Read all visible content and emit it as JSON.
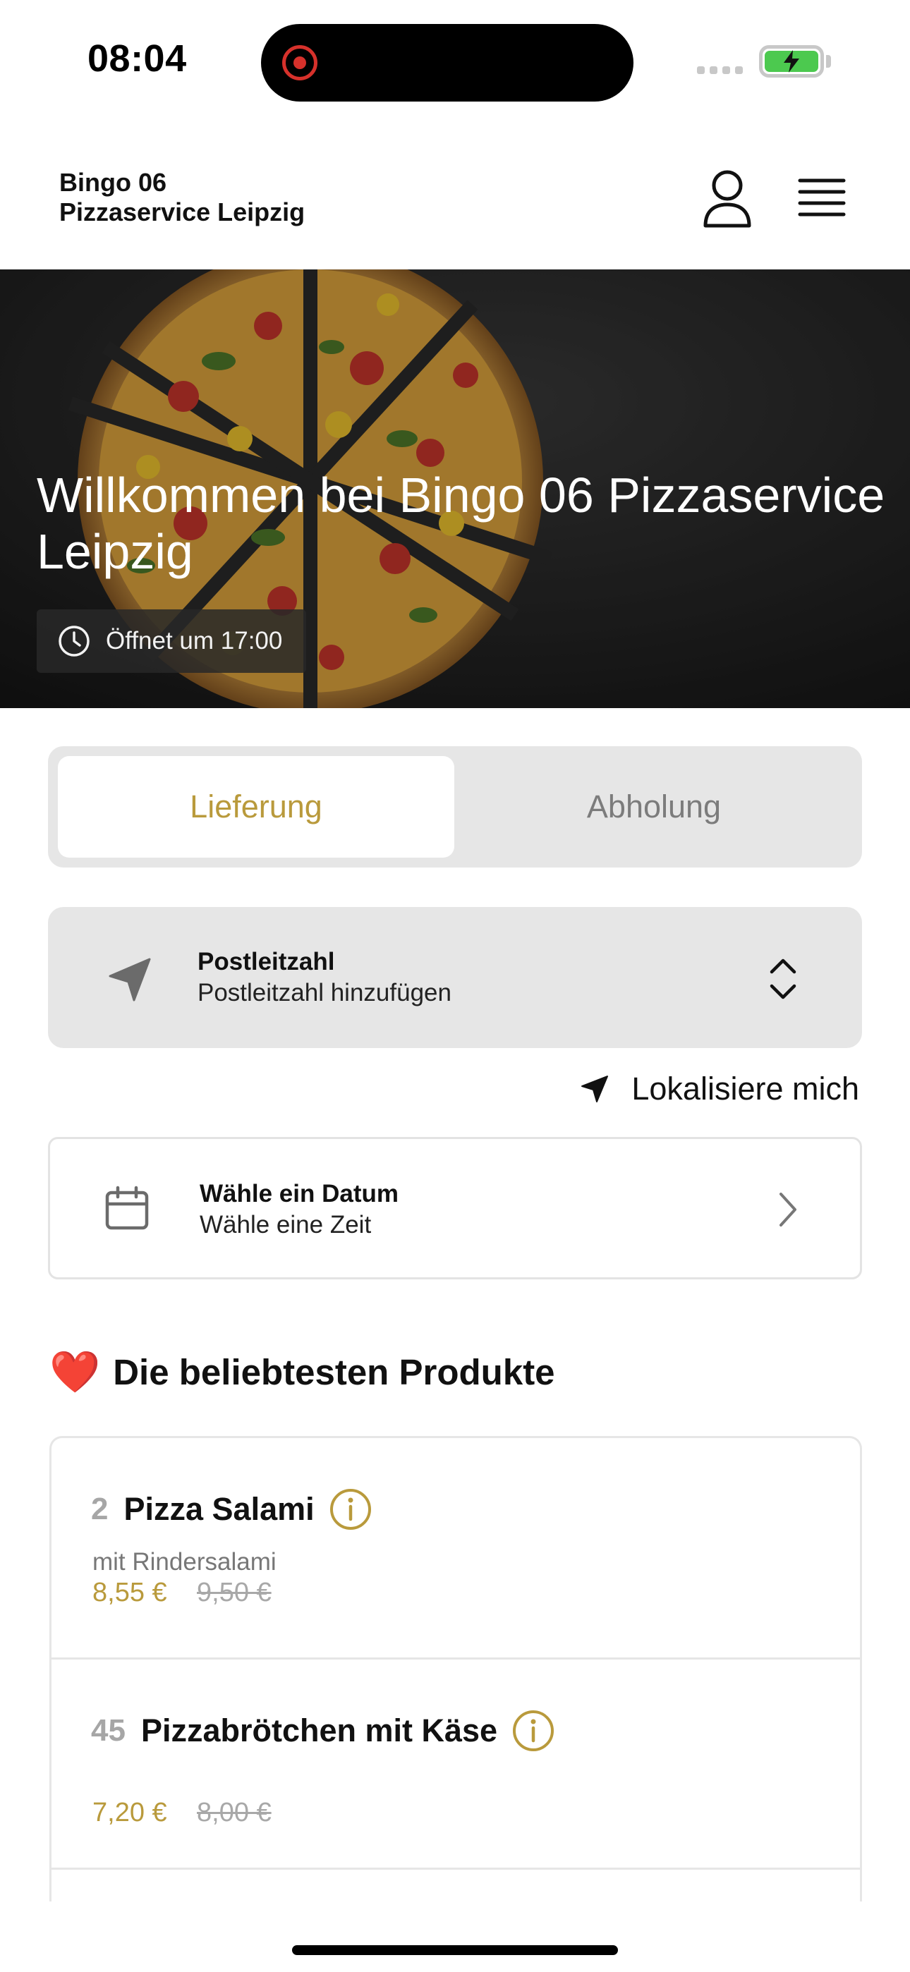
{
  "status_bar": {
    "time": "08:04"
  },
  "header": {
    "brand_line1": "Bingo 06",
    "brand_line2": "Pizzaservice Leipzig",
    "user_icon": "person-icon",
    "menu_icon": "hamburger-menu-icon"
  },
  "hero": {
    "title": "Willkommen bei Bingo 06 Pizzaservice Leipzig",
    "hours": "Öffnet um 17:00",
    "hours_icon": "clock-icon"
  },
  "mode": {
    "delivery": "Lieferung",
    "pickup": "Abholung",
    "selected": "Lieferung"
  },
  "postcode": {
    "label": "Postleitzahl",
    "placeholder": "Postleitzahl hinzufügen",
    "icon": "location-arrow-icon"
  },
  "locate": {
    "label": "Lokalisiere mich",
    "icon": "location-arrow-icon"
  },
  "date": {
    "label": "Wähle ein Datum",
    "time": "Wähle eine Zeit",
    "icon": "calendar-icon"
  },
  "popular": {
    "emoji": "❤️",
    "title": "Die beliebtesten Produkte",
    "items": [
      {
        "number": "2",
        "name": "Pizza Salami",
        "description": "mit Rindersalami",
        "price": "8,55 €",
        "old_price": "9,50 €"
      },
      {
        "number": "45",
        "name": "Pizzabrötchen mit Käse",
        "description": "",
        "price": "7,20 €",
        "old_price": "8,00 €"
      }
    ]
  },
  "colors": {
    "accent": "#b99a3c",
    "panel": "#e6e6e6",
    "recording": "#d6312b",
    "battery": "#4cc94f"
  }
}
